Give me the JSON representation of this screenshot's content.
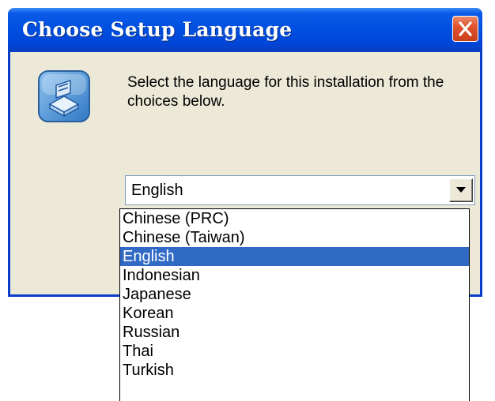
{
  "window": {
    "title": "Choose Setup Language",
    "close_icon": "close-icon"
  },
  "dialog": {
    "icon": "setup-installer-icon",
    "message": "Select the language for this installation from the choices below."
  },
  "language_select": {
    "selected": "English",
    "arrow_icon": "chevron-down-icon",
    "options": [
      "Chinese (PRC)",
      "Chinese (Taiwan)",
      "English",
      "Indonesian",
      "Japanese",
      "Korean",
      "Russian",
      "Thai",
      "Turkish"
    ],
    "highlighted_index": 2
  },
  "colors": {
    "titlebar": "#0050e0",
    "window_bg": "#ece9d8",
    "selection": "#316ac5",
    "close_button": "#e0542e"
  }
}
